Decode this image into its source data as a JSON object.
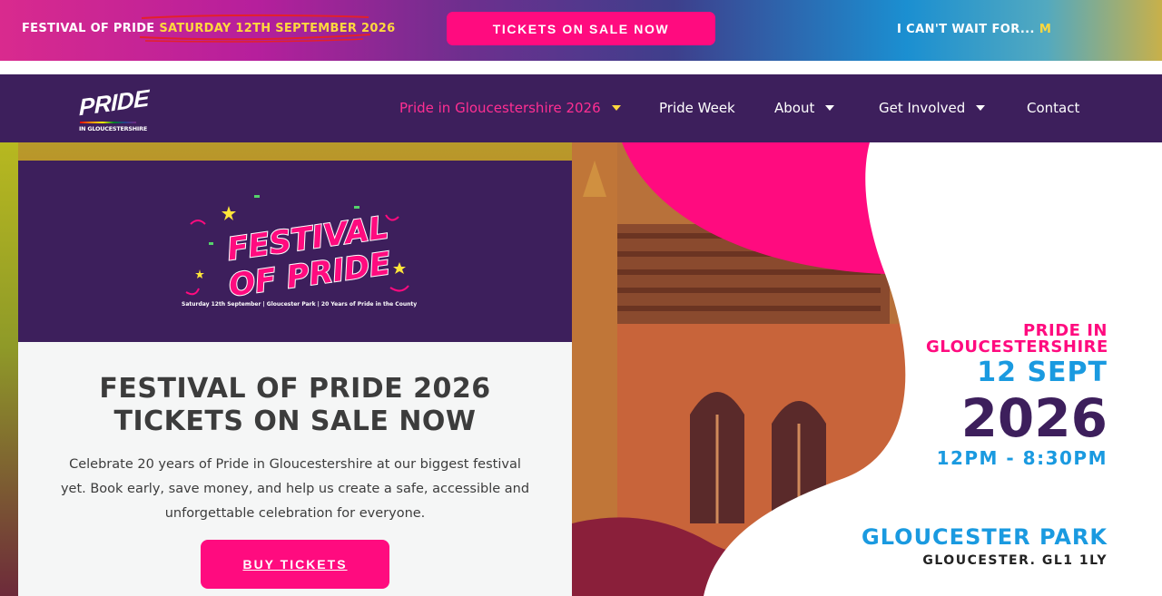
{
  "topbar": {
    "festival_label": "FESTIVAL OF PRIDE",
    "festival_date": "SATURDAY 12TH SEPTEMBER 2026",
    "tickets_button": "TICKETS ON SALE NOW",
    "countdown_label": "I CAN'T WAIT FOR...",
    "countdown_typed": "M"
  },
  "logo": {
    "word": "PRIDE",
    "subtitle": "IN GLOUCESTERSHIRE"
  },
  "nav": {
    "items": [
      {
        "label": "Pride in Gloucestershire 2026",
        "has_dropdown": true,
        "active": true
      },
      {
        "label": "Pride Week",
        "has_dropdown": false,
        "active": false
      },
      {
        "label": "About",
        "has_dropdown": true,
        "active": false
      },
      {
        "label": "Get Involved",
        "has_dropdown": true,
        "active": false
      },
      {
        "label": "Contact",
        "has_dropdown": false,
        "active": false
      }
    ]
  },
  "card": {
    "festival_logo_line1": "FESTIVAL",
    "festival_logo_line2": "OF PRIDE",
    "festival_logo_caption": "Saturday 12th September  |  Gloucester Park  |  20 Years of Pride in the County",
    "title": "FESTIVAL OF PRIDE 2026 TICKETS ON SALE NOW",
    "text": "Celebrate 20 years of Pride in Gloucestershire at our biggest festival yet. Book early, save money, and help us create a safe, accessible and unforgettable celebration for everyone.",
    "button": "BUY TICKETS"
  },
  "event_info": {
    "organisation": "PRIDE IN GLOUCESTERSHIRE",
    "day": "12 SEPT",
    "year": "2026",
    "time": "12PM - 8:30PM",
    "venue": "GLOUCESTER PARK",
    "address": "GLOUCESTER. GL1 1LY"
  },
  "colors": {
    "brand_pink": "#ff0b7f",
    "brand_purple": "#3d1f5c",
    "brand_blue": "#1a9ae0",
    "highlight_yellow": "#ffd83d"
  },
  "icons": [
    "dropdown-caret-icon",
    "scribble-underline-icon",
    "star-icon",
    "confetti-icon"
  ]
}
